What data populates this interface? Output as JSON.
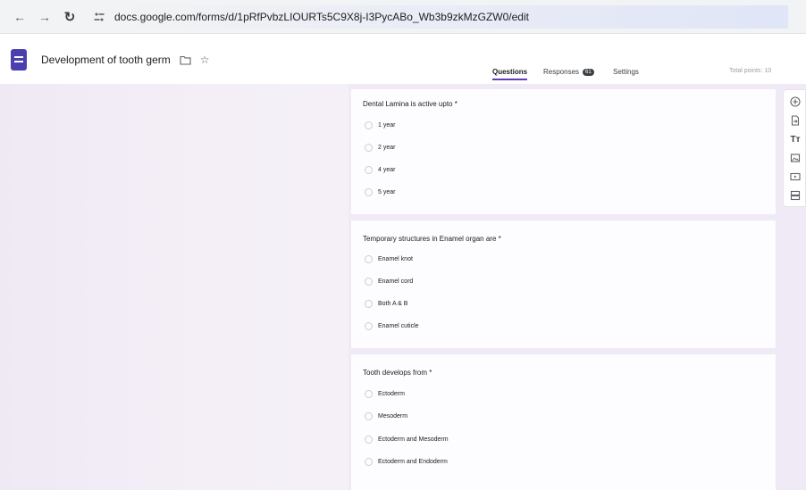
{
  "browser": {
    "url": "docs.google.com/forms/d/1pRfPvbzLIOURTs5C9X8j-I3PycABo_Wb3b9zkMzGZW0/edit"
  },
  "form": {
    "title": "Development of tooth germ"
  },
  "tabs": {
    "questions": "Questions",
    "responses": "Responses",
    "responses_count": "61",
    "settings": "Settings",
    "total_points": "Total points: 10"
  },
  "questions": [
    {
      "title": "Dental Lamina is active upto *",
      "options": [
        "1 year",
        "2 year",
        "4 year",
        "5 year"
      ]
    },
    {
      "title": "Temporary structures in Enamel organ are *",
      "options": [
        "Enamel knot",
        "Enamel cord",
        "Both A & B",
        "Enamel cuticle"
      ]
    },
    {
      "title": "Tooth develops from *",
      "options": [
        "Ectoderm",
        "Mesoderm",
        "Ectoderm and Mesoderm",
        "Ectoderm and Endoderm"
      ]
    }
  ],
  "toolbar": {
    "icons": [
      "add-question-icon",
      "import-questions-icon",
      "add-title-icon",
      "add-image-icon",
      "add-video-icon",
      "add-section-icon"
    ],
    "title_glyph": "Tт"
  },
  "colors": {
    "accent": "#673ab7",
    "background": "#f0eaf6",
    "forms_icon": "#4b3fb0"
  }
}
